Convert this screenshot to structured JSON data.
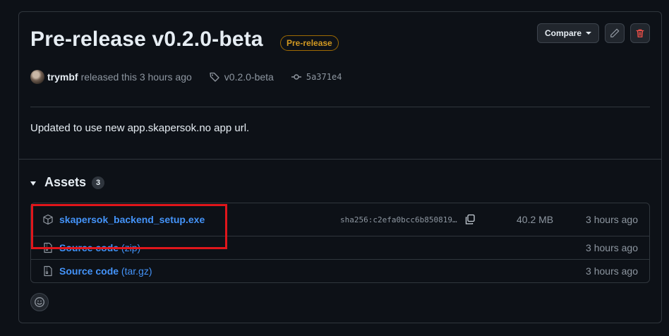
{
  "release": {
    "title": "Pre-release v0.2.0-beta",
    "badge": "Pre-release",
    "author": "trymbf",
    "released_text": "released this 3 hours ago",
    "tag": "v0.2.0-beta",
    "commit": "5a371e4",
    "notes": "Updated to use new app.skapersok.no app url."
  },
  "toolbar": {
    "compare_label": "Compare"
  },
  "assets": {
    "heading": "Assets",
    "count": "3",
    "items": [
      {
        "name": "skapersok_backend_setup.exe",
        "sha": "sha256:c2efa0bcc6b850819…",
        "size": "40.2 MB",
        "time": "3 hours ago"
      },
      {
        "name": "Source code",
        "ext": "(zip)",
        "time": "3 hours ago"
      },
      {
        "name": "Source code",
        "ext": "(tar.gz)",
        "time": "3 hours ago"
      }
    ]
  },
  "colors": {
    "background": "#0d1117",
    "link": "#4493f8",
    "prerelease": "#d29922",
    "highlight": "#e0161b",
    "danger": "#f85149"
  },
  "icons": [
    "pencil-icon",
    "trash-icon",
    "tag-icon",
    "commit-icon",
    "package-icon",
    "file-zip-icon",
    "copy-icon",
    "smiley-icon"
  ]
}
